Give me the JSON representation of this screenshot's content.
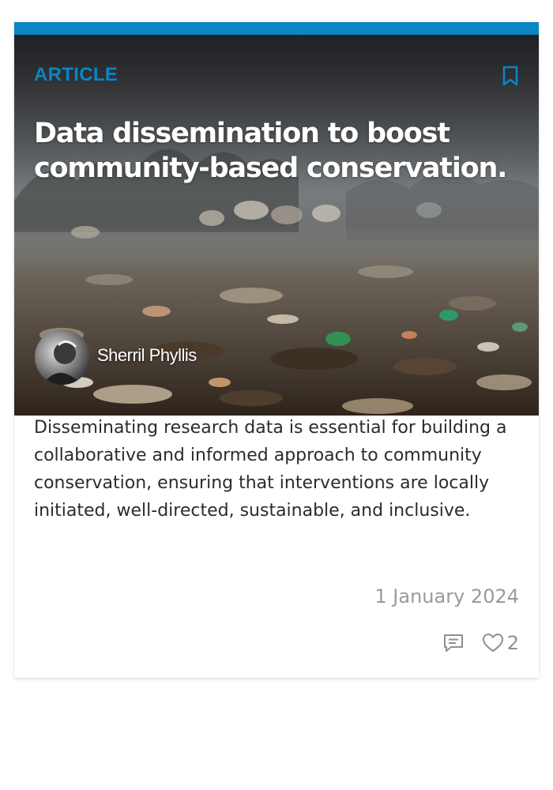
{
  "card": {
    "label": "ARTICLE",
    "title": "Data dissemination to boost community-based conservation.",
    "author": "Sherril Phyllis",
    "description": "Disseminating research data is essential for building a collaborative and informed approach to community conservation, ensuring that interventions are locally initiated, well-directed, sustainable, and inclusive.",
    "date": "1 January 2024",
    "likes": "2"
  },
  "icons": {
    "bookmark": "bookmark-icon",
    "comment": "comment-icon",
    "like": "heart-icon"
  },
  "colors": {
    "accent": "#0a86c2",
    "top_bar": "#0a86c2",
    "meta_text": "#9a9a9a"
  }
}
